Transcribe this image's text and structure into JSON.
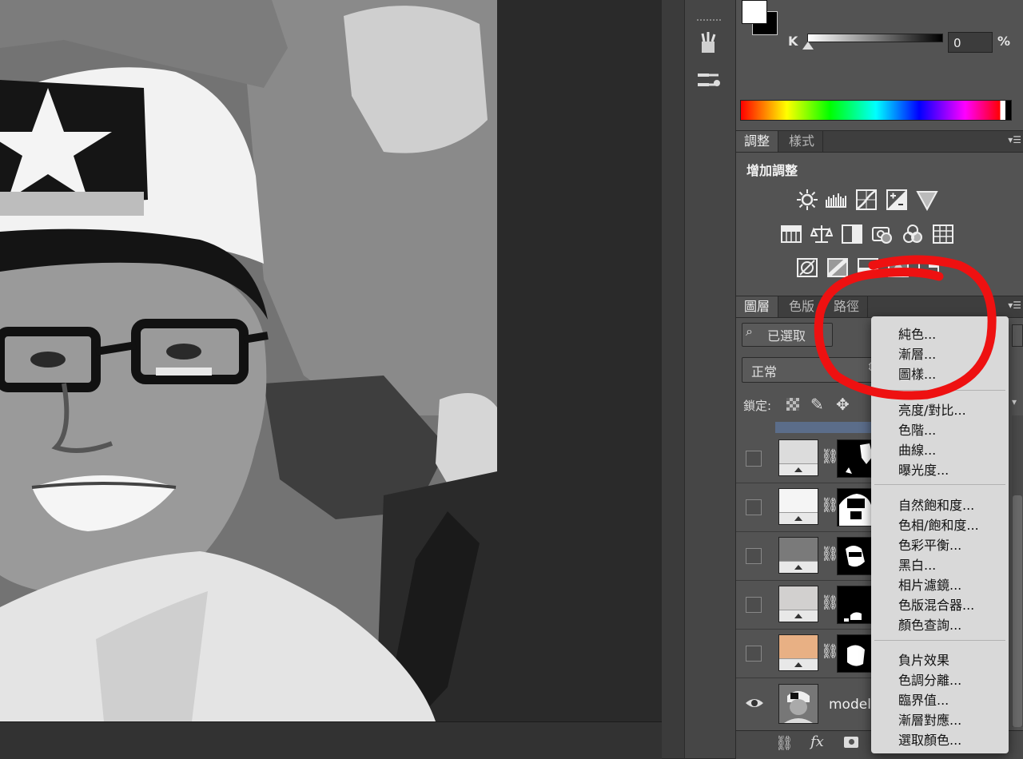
{
  "color_panel": {
    "channel_label": "K",
    "value": "0",
    "unit": "%",
    "slider_fraction": 0.0
  },
  "adjust_panel": {
    "tabs": [
      {
        "label": "調整"
      },
      {
        "label": "樣式"
      }
    ],
    "title": "增加調整"
  },
  "layers_panel": {
    "tabs": [
      {
        "label": "圖層"
      },
      {
        "label": "色版"
      },
      {
        "label": "路徑"
      }
    ],
    "filter_label": "已選取",
    "blend_mode": "正常",
    "lock_label": "鎖定:",
    "base_layer_name": "model",
    "footer_fx": "fx"
  },
  "adjustment_menu": {
    "groups": [
      [
        "純色...",
        "漸層...",
        "圖樣..."
      ],
      [
        "亮度/對比...",
        "色階...",
        "曲線...",
        "曝光度..."
      ],
      [
        "自然飽和度...",
        "色相/飽和度...",
        "色彩平衡...",
        "黑白...",
        "相片濾鏡...",
        "色版混合器...",
        "顏色查詢..."
      ],
      [
        "負片效果",
        "色調分離...",
        "臨界值...",
        "漸層對應...",
        "選取顏色..."
      ]
    ]
  },
  "colors": {
    "annotation": "#ee1111",
    "layer_fill_swatch": "#e8b084"
  }
}
